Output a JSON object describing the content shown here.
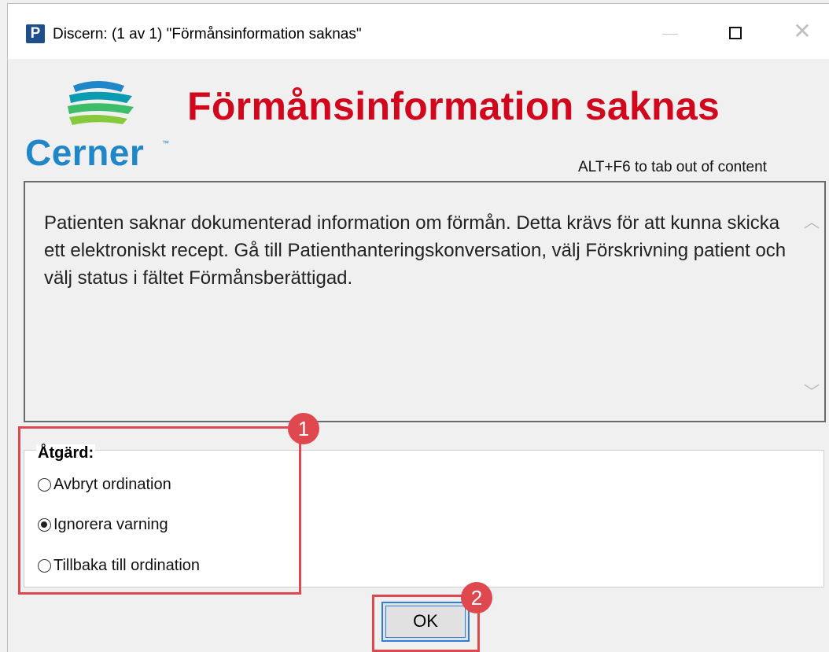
{
  "window": {
    "icon_letter": "P",
    "title": "Discern:  (1 av 1) \"Förmånsinformation saknas\""
  },
  "logo": {
    "text": "Cerner"
  },
  "heading": "Förmånsinformation saknas",
  "alt_hint": "ALT+F6 to tab out of content",
  "message": "Patienten saknar dokumenterad information om förmån. Detta krävs för att kunna skicka ett elektroniskt recept. Gå till Patienthanteringskonversation, välj Förskrivning patient och välj status i fältet Förmånsberättigad.",
  "action": {
    "label": "Åtgärd:",
    "options": [
      {
        "label": "Avbryt ordination",
        "checked": false
      },
      {
        "label": "Ignorera varning",
        "checked": true
      },
      {
        "label": "Tillbaka till ordination",
        "checked": false
      }
    ]
  },
  "buttons": {
    "ok": "OK"
  },
  "callouts": {
    "badge_1": "1",
    "badge_2": "2"
  },
  "colors": {
    "heading": "#d1081d",
    "logo_blue": "#1f86c8",
    "callout": "#e0484f",
    "focus": "#2f7fd8"
  }
}
